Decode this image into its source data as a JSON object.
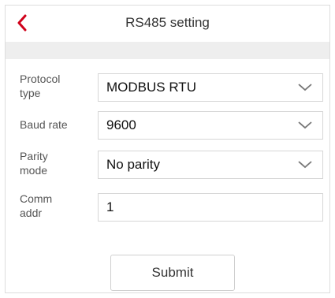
{
  "header": {
    "title": "RS485 setting",
    "back_icon": "chevron-left-icon",
    "accent_color": "#d0021b"
  },
  "form": {
    "protocol": {
      "label_line1": "Protocol",
      "label_line2": "type",
      "value": "MODBUS RTU"
    },
    "baud": {
      "label": "Baud rate",
      "value": "9600"
    },
    "parity": {
      "label_line1": "Parity",
      "label_line2": "mode",
      "value": "No parity"
    },
    "comm_addr": {
      "label_line1": "Comm",
      "label_line2": "addr",
      "value": "1"
    }
  },
  "submit_label": "Submit",
  "icons": {
    "dropdown": "chevron-down-icon"
  }
}
